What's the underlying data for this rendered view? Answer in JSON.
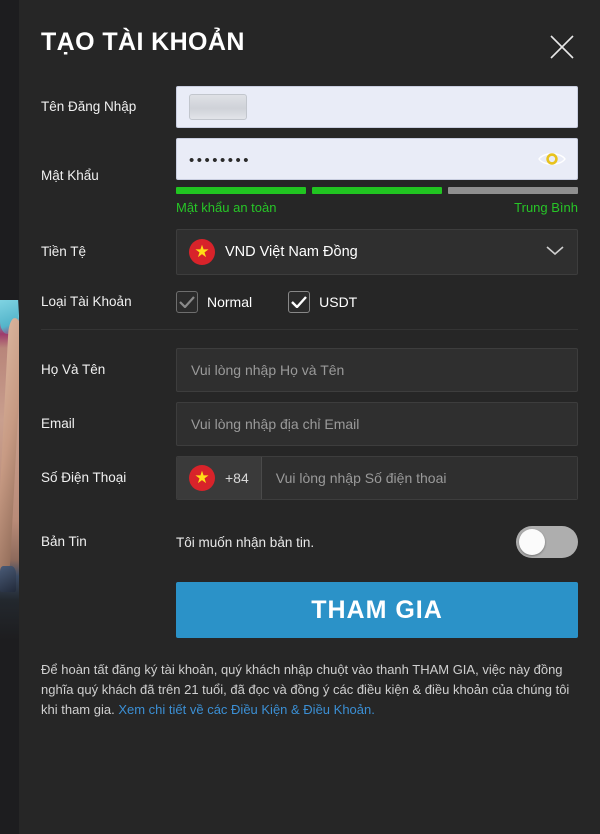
{
  "modal": {
    "title": "TẠO TÀI KHOẢN",
    "close_icon": "close-icon"
  },
  "fields": {
    "username": {
      "label": "Tên Đăng Nhập",
      "value": "",
      "placeholder": ""
    },
    "password": {
      "label": "Mật Khẩu",
      "value": "••••••••",
      "reveal_icon": "eye-icon",
      "strength_segments": [
        true,
        true,
        false
      ],
      "strength_message": "Mật khẩu an toàn",
      "strength_level": "Trung Bình",
      "strength_color": "#21c521",
      "inactive_color": "#8f8f8f"
    },
    "currency": {
      "label": "Tiền Tệ",
      "selected": "VND Việt Nam Đồng",
      "flag_icon": "vietnam-flag-icon",
      "caret_icon": "chevron-down-icon"
    },
    "account_type": {
      "label": "Loại Tài Khoản",
      "options": [
        {
          "label": "Normal",
          "checked": true,
          "dimmed": true
        },
        {
          "label": "USDT",
          "checked": true,
          "dimmed": false
        }
      ]
    },
    "full_name": {
      "label": "Họ Và Tên",
      "value": "",
      "placeholder": "Vui lòng nhập Họ và Tên"
    },
    "email": {
      "label": "Email",
      "value": "",
      "placeholder": "Vui lòng nhập địa chỉ Email"
    },
    "phone": {
      "label": "Số Điện Thoại",
      "dial_code": "+84",
      "flag_icon": "vietnam-flag-icon",
      "value": "",
      "placeholder": "Vui lòng nhập Số điện thoai"
    },
    "newsletter": {
      "label": "Bản Tin",
      "text": "Tôi muốn nhận bản tin.",
      "enabled": false
    }
  },
  "submit": {
    "label": "THAM GIA",
    "color": "#2b92c8"
  },
  "footer": {
    "text": "Để hoàn tất đăng ký tài khoản, quý khách nhập chuột vào thanh THAM GIA, việc này đồng nghĩa quý khách đã trên 21 tuổi, đã đọc và đồng ý các điều kiện & điều khoản của chúng tôi khi tham gia. ",
    "link_text": "Xem chi tiết về các Điều Kiện & Điều Khoản.",
    "link_color": "#3b8fd4"
  }
}
